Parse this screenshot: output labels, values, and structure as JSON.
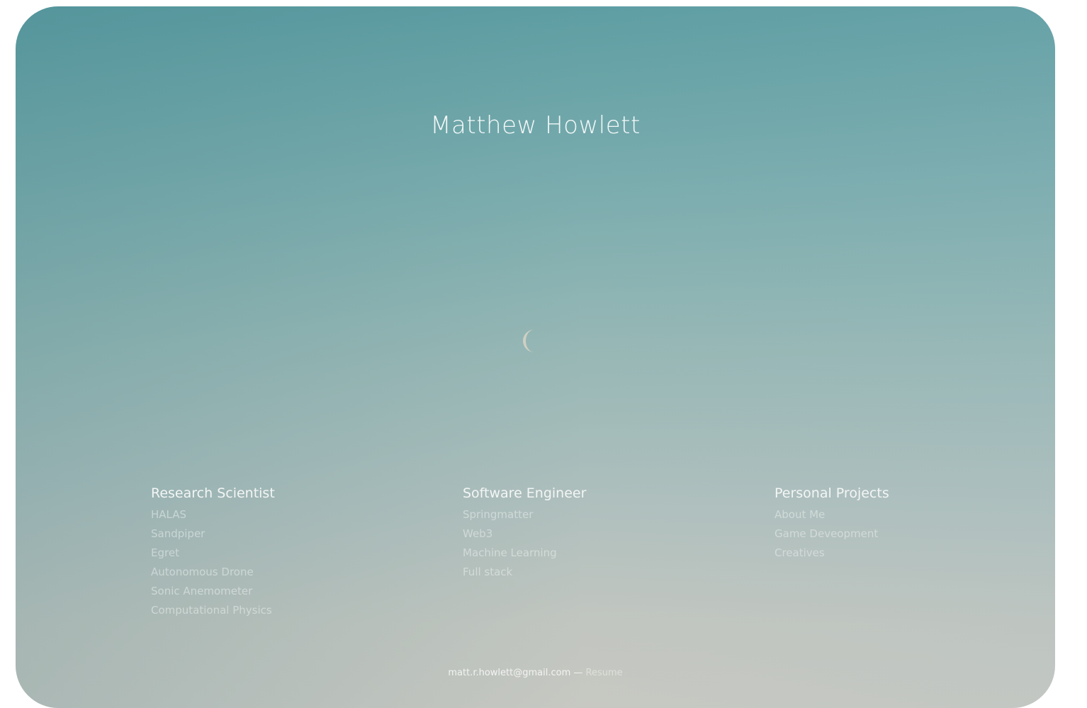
{
  "header": {
    "name": "Matthew Howlett"
  },
  "columns": [
    {
      "heading": "Research Scientist",
      "links": [
        "HALAS",
        "Sandpiper",
        "Egret",
        "Autonomous Drone",
        "Sonic Anemometer",
        "Computational Physics"
      ]
    },
    {
      "heading": "Software Engineer",
      "links": [
        "Springmatter",
        "Web3",
        "Machine Learning",
        "Full stack"
      ]
    },
    {
      "heading": "Personal Projects",
      "links": [
        "About Me",
        "Game Deveopment",
        "Creatives"
      ]
    }
  ],
  "footer": {
    "email": "matt.r.howlett@gmail.com",
    "separator": " — ",
    "resume_label": "Resume"
  },
  "colors": {
    "sky_top": "#5e9ea3",
    "sky_bottom": "#c7c8c2",
    "moon": "#d9d3c6"
  },
  "icons": {
    "moon": "crescent-moon-icon"
  }
}
